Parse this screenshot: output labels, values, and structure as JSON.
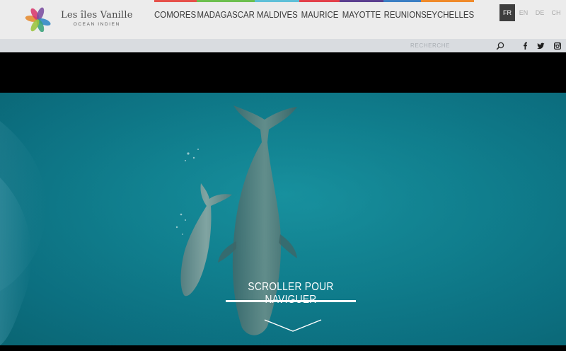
{
  "brand": {
    "name": "Les îles Vanille",
    "tagline": "OCEAN INDIEN",
    "petal_colors": [
      "#e58a2e",
      "#d8386d",
      "#7b4fa0",
      "#2f86c5",
      "#3aa37a",
      "#9bc43c"
    ]
  },
  "nav": {
    "items": [
      {
        "label": "COMORES",
        "color": "#e6504a"
      },
      {
        "label": "MADAGASCAR",
        "color": "#6cbf4e"
      },
      {
        "label": "MALDIVES",
        "color": "#5fc0d8"
      },
      {
        "label": "MAURICE",
        "color": "#e3404a"
      },
      {
        "label": "MAYOTTE",
        "color": "#5b3f8f"
      },
      {
        "label": "REUNION",
        "color": "#3b7fc4"
      },
      {
        "label": "SEYCHELLES",
        "color": "#f08a2a"
      }
    ]
  },
  "languages": {
    "items": [
      "FR",
      "EN",
      "DE",
      "CH"
    ],
    "active": "FR"
  },
  "search": {
    "placeholder": "RECHERCHE",
    "icon": "search-icon"
  },
  "social": {
    "items": [
      "facebook-icon",
      "twitter-icon",
      "instagram-icon"
    ]
  },
  "hero": {
    "scroll_label": "SCROLLER POUR NAVIGUER",
    "arrow_icon": "chevron-down-icon"
  }
}
